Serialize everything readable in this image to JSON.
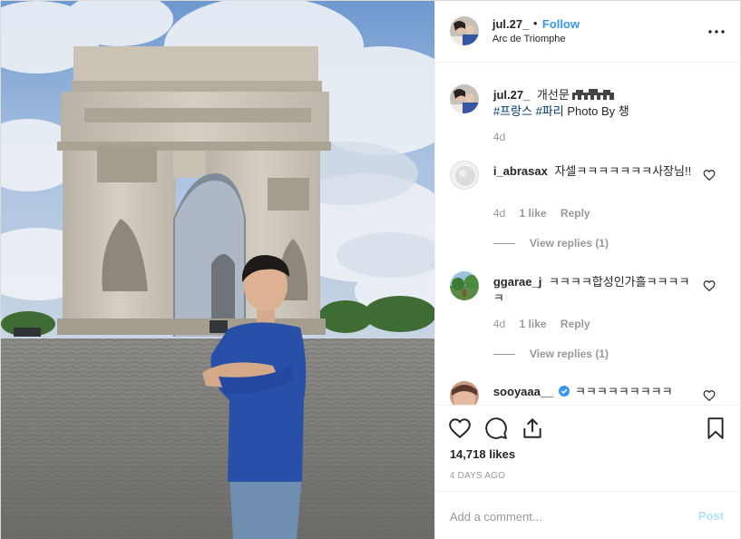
{
  "post": {
    "username": "jul.27_",
    "dot": "•",
    "follow_label": "Follow",
    "location": "Arc de Triomphe",
    "more_icon": "more-dots-icon"
  },
  "caption": {
    "username": "jul.27_",
    "text": "개선문",
    "hashtags": [
      "#프랑스",
      "#파리"
    ],
    "text2": "Photo By 챙",
    "time": "4d"
  },
  "comments": [
    {
      "username": "i_abrasax",
      "text": "자셀ㅋㅋㅋㅋㅋㅋㅋ사장님!!",
      "time": "4d",
      "likes": "1 like",
      "reply": "Reply",
      "view_replies": "View replies (1)"
    },
    {
      "username": "ggarae_j",
      "text": "ㅋㅋㅋㅋ합성인가흘ㅋㅋㅋㅋㅋ",
      "time": "4d",
      "likes": "1 like",
      "reply": "Reply",
      "view_replies": "View replies (1)"
    },
    {
      "username": "sooyaaa__",
      "text": "ㅋㅋㅋㅋㅋㅋㅋㅋㅋ",
      "verified": true
    }
  ],
  "stats": {
    "likes": "14,718 likes",
    "time_ago": "4 DAYS AGO"
  },
  "composer": {
    "placeholder": "Add a comment...",
    "post_label": "Post"
  },
  "colors": {
    "accent": "#3897f0",
    "hashtag": "#003569",
    "muted": "#999999",
    "post_disabled": "#b2dffc"
  }
}
